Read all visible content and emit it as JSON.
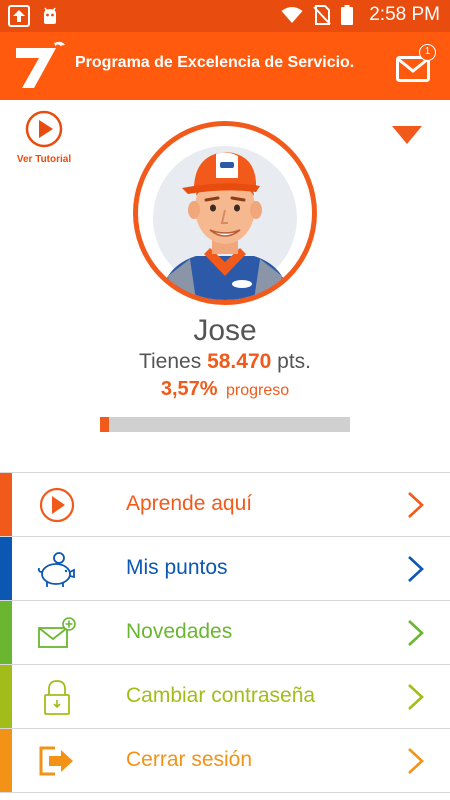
{
  "status_bar": {
    "time": "2:58 PM"
  },
  "header": {
    "title": "Programa de Excelencia de Servicio.",
    "notifications_count": "1"
  },
  "tutorial": {
    "label": "Ver Tutorial"
  },
  "profile": {
    "name": "Jose",
    "points_prefix": "Tienes",
    "points_value": "58.470",
    "points_suffix": "pts.",
    "progress_value": "3,57%",
    "progress_label": "progreso",
    "progress_fraction": 0.0357
  },
  "menu": [
    {
      "label": "Aprende aquí",
      "icon": "play-circle-icon",
      "color": "#f25a1b"
    },
    {
      "label": "Mis puntos",
      "icon": "piggy-bank-icon",
      "color": "#0b57b3"
    },
    {
      "label": "Novedades",
      "icon": "mail-plus-icon",
      "color": "#6ab630"
    },
    {
      "label": "Cambiar contraseña",
      "icon": "lock-icon",
      "color": "#a2bd1a"
    },
    {
      "label": "Cerrar sesión",
      "icon": "logout-icon",
      "color": "#f29318"
    }
  ],
  "colors": {
    "status_bar": "#e84c0e",
    "header": "#ff5a0e",
    "accent": "#f25a1b"
  }
}
